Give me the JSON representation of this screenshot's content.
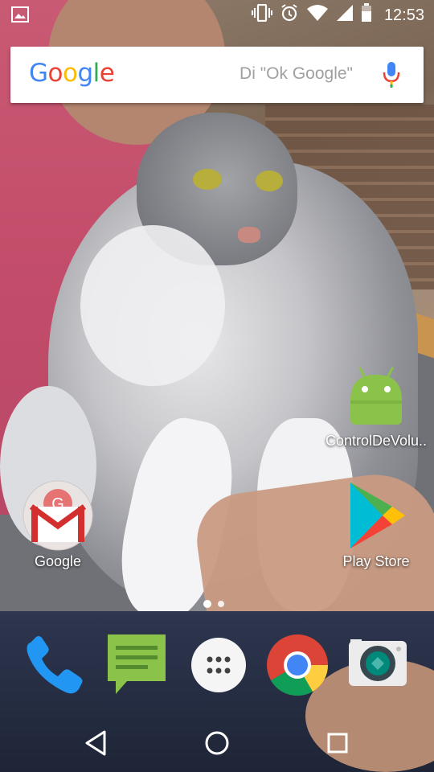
{
  "status_bar": {
    "time": "12:53",
    "icons": [
      "image-notification-icon",
      "vibrate-icon",
      "alarm-icon",
      "wifi-icon",
      "signal-icon",
      "battery-icon"
    ]
  },
  "search": {
    "logo": "Google",
    "hint": "Di \"Ok Google\"",
    "mic_icon": "mic-icon"
  },
  "apps": {
    "controldevolumen": {
      "label": "ControlDeVolu..",
      "icon": "android-icon"
    },
    "google": {
      "label": "Google",
      "icon": "gmail-folder-icon"
    },
    "play_store": {
      "label": "Play Store",
      "icon": "play-store-icon"
    }
  },
  "page_indicator": {
    "pages": 2,
    "current": 1
  },
  "dock": [
    {
      "name": "phone",
      "icon": "phone-icon"
    },
    {
      "name": "messages",
      "icon": "messages-icon"
    },
    {
      "name": "app-drawer",
      "icon": "app-drawer-icon"
    },
    {
      "name": "chrome",
      "icon": "chrome-icon"
    },
    {
      "name": "camera",
      "icon": "camera-icon"
    }
  ],
  "nav": [
    "back-icon",
    "home-icon",
    "recents-icon"
  ],
  "colors": {
    "google_blue": "#4285F4",
    "google_red": "#EA4335",
    "google_yellow": "#FBBC05",
    "google_green": "#34A853",
    "android_green": "#8BC34A"
  }
}
